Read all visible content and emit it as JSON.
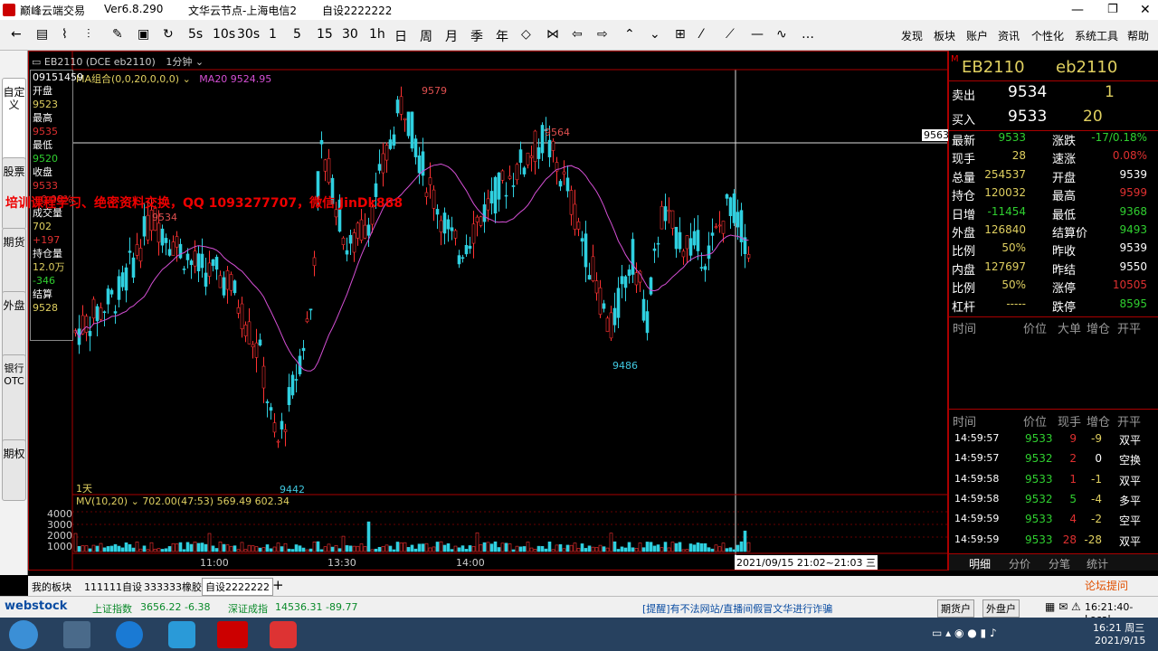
{
  "window": {
    "app": "巅峰云端交易",
    "version": "Ver6.8.290",
    "node": "文华云节点-上海电信2",
    "custom": "自设2222222"
  },
  "toolbar": {
    "items": [
      "5s",
      "10s",
      "30s",
      "1",
      "5",
      "15",
      "30",
      "1h",
      "日",
      "周",
      "月",
      "季",
      "年"
    ],
    "menus": [
      "发现",
      "板块",
      "账户",
      "资讯",
      "个性化",
      "系统工具",
      "帮助"
    ]
  },
  "sidebar": [
    "自定义",
    "股票",
    "期货",
    "外盘",
    "银行OTC",
    "期权"
  ],
  "chart": {
    "header": "EB2110 (DCE eb2110)",
    "period": "1分钟",
    "ma_label": "MA组合(0,0,20,0,0,0)",
    "ma_value": "MA20 9524.95",
    "time": "09151459",
    "info": [
      [
        "开盘",
        "9523"
      ],
      [
        "最高",
        "9535"
      ],
      [
        "最低",
        "9520"
      ],
      [
        "收盘",
        "9533"
      ],
      [
        "",
        "+0.08%"
      ],
      [
        "成交量",
        "702"
      ],
      [
        "",
        "+197"
      ],
      [
        "持仓量",
        "12.0万"
      ],
      [
        "",
        "-346"
      ],
      [
        "结算",
        "9528"
      ]
    ],
    "watermark": "培训课程学习、绝密资料交换，QQ 1093277707，微信 JinDk888",
    "day_label": "1天",
    "crosshair_price": "9563",
    "annotations": [
      "9579",
      "9564",
      "9534",
      "9486",
      "9442"
    ],
    "vol_label": "MV(10,20)",
    "vol_values": "702.00(47:53)  569.49  602.34",
    "vol_ticks": [
      "4000",
      "3000",
      "2000",
      "1000"
    ],
    "x_ticks": [
      "11:00",
      "13:30",
      "14:00"
    ],
    "crosshair_time": "2021/09/15 21:02~21:03 三"
  },
  "chart_data": {
    "type": "candlestick",
    "ylim": [
      9430,
      9590
    ],
    "x_ticks": [
      "11:00",
      "13:30",
      "14:00"
    ],
    "highs": [
      "9579",
      "9564",
      "9534"
    ],
    "lows": [
      "9486",
      "9442"
    ],
    "ma": "MA20 9524.95",
    "volume": {
      "ma": [
        "569.49",
        "602.34"
      ],
      "last": "702.00"
    }
  },
  "right": {
    "code": "EB2110",
    "name": "eb2110",
    "sell": {
      "label": "卖出",
      "price": "9534",
      "vol": "1"
    },
    "buy": {
      "label": "买入",
      "price": "9533",
      "vol": "20"
    },
    "stats": [
      [
        "最新",
        "9533",
        "涨跌",
        "-17/0.18%"
      ],
      [
        "现手",
        "28",
        "速涨",
        "0.08%"
      ],
      [
        "总量",
        "254537",
        "开盘",
        "9539"
      ],
      [
        "持仓",
        "120032",
        "最高",
        "9599"
      ],
      [
        "日增",
        "-11454",
        "最低",
        "9368"
      ],
      [
        "外盘",
        "126840",
        "结算价",
        "9493"
      ],
      [
        "比例",
        "50%",
        "昨收",
        "9539"
      ],
      [
        "内盘",
        "127697",
        "昨结",
        "9550"
      ],
      [
        "比例",
        "50%",
        "涨停",
        "10505"
      ],
      [
        "杠杆",
        "-----",
        "跌停",
        "8595"
      ]
    ],
    "hdr1": [
      "时间",
      "价位",
      "大单",
      "增仓",
      "开平"
    ],
    "hdr2": [
      "时间",
      "价位",
      "现手",
      "增仓",
      "开平"
    ],
    "ticks": [
      [
        "14:59:57",
        "9533",
        "9",
        "-9",
        "双平"
      ],
      [
        "14:59:57",
        "9532",
        "2",
        "0",
        "空换"
      ],
      [
        "14:59:58",
        "9533",
        "1",
        "-1",
        "双平"
      ],
      [
        "14:59:58",
        "9532",
        "5",
        "-4",
        "多平"
      ],
      [
        "14:59:59",
        "9533",
        "4",
        "-2",
        "空平"
      ],
      [
        "14:59:59",
        "9533",
        "28",
        "-28",
        "双平"
      ]
    ],
    "tabs": [
      "明细",
      "分价",
      "分笔",
      "统计"
    ],
    "forum": "论坛提问"
  },
  "tabs": [
    "我的板块",
    "111111自设",
    "333333橡胶",
    "自设2222222"
  ],
  "status": {
    "logo": "webstock",
    "sh": "上证指数",
    "sh_val": "3656.22 -6.38",
    "sz": "深证成指",
    "sz_val": "14536.31 -89.77",
    "notice": "[提醒]有不法网站/直播间假冒文华进行诈骗",
    "btn1": "期货户",
    "btn2": "外盘户",
    "clock": "16:21:40-Local"
  },
  "taskbar": {
    "time": "16:21 周三",
    "date": "2021/9/15"
  }
}
